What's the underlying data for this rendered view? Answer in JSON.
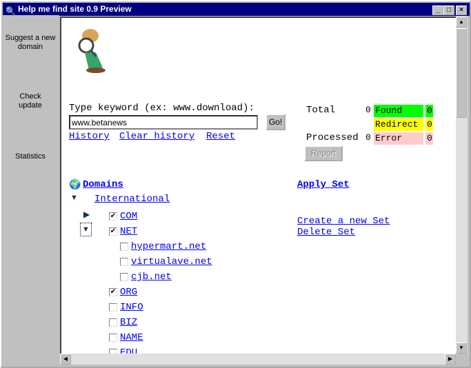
{
  "window": {
    "title": "Help me find site 0.9 Preview"
  },
  "sidebar": {
    "items": [
      {
        "label": "Suggest a new domain"
      },
      {
        "label": "Check update"
      },
      {
        "label": "Statistics"
      }
    ]
  },
  "search": {
    "label": "Type keyword (ex: www.download):",
    "value": "www.betanews",
    "go": "Go!",
    "links": [
      "History",
      "Clear history",
      "Reset"
    ]
  },
  "stats": {
    "total_label": "Total",
    "total": "0",
    "processed_label": "Processed",
    "processed": "0",
    "found_label": "Found",
    "found": "0",
    "redirect_label": "Redirect",
    "redirect": "0",
    "error_label": "Error",
    "error": "0",
    "report": "Report",
    "colors": {
      "found": "#00ff00",
      "redirect": "#ffff00",
      "error": "#ffcccc"
    }
  },
  "domains": {
    "title": "Domains",
    "group": "International",
    "items": [
      {
        "label": "COM",
        "checked": true
      },
      {
        "label": "NET",
        "checked": true
      },
      {
        "label": "hypermart.net",
        "checked": false
      },
      {
        "label": "virtualave.net",
        "checked": false
      },
      {
        "label": "cjb.net",
        "checked": false
      },
      {
        "label": "ORG",
        "checked": true
      },
      {
        "label": "INFO",
        "checked": false
      },
      {
        "label": "BIZ",
        "checked": false
      },
      {
        "label": "NAME",
        "checked": false
      },
      {
        "label": "EDU",
        "checked": false
      }
    ]
  },
  "sets": {
    "apply": "Apply Set",
    "create": "Create a new Set",
    "delete": "Delete Set"
  }
}
